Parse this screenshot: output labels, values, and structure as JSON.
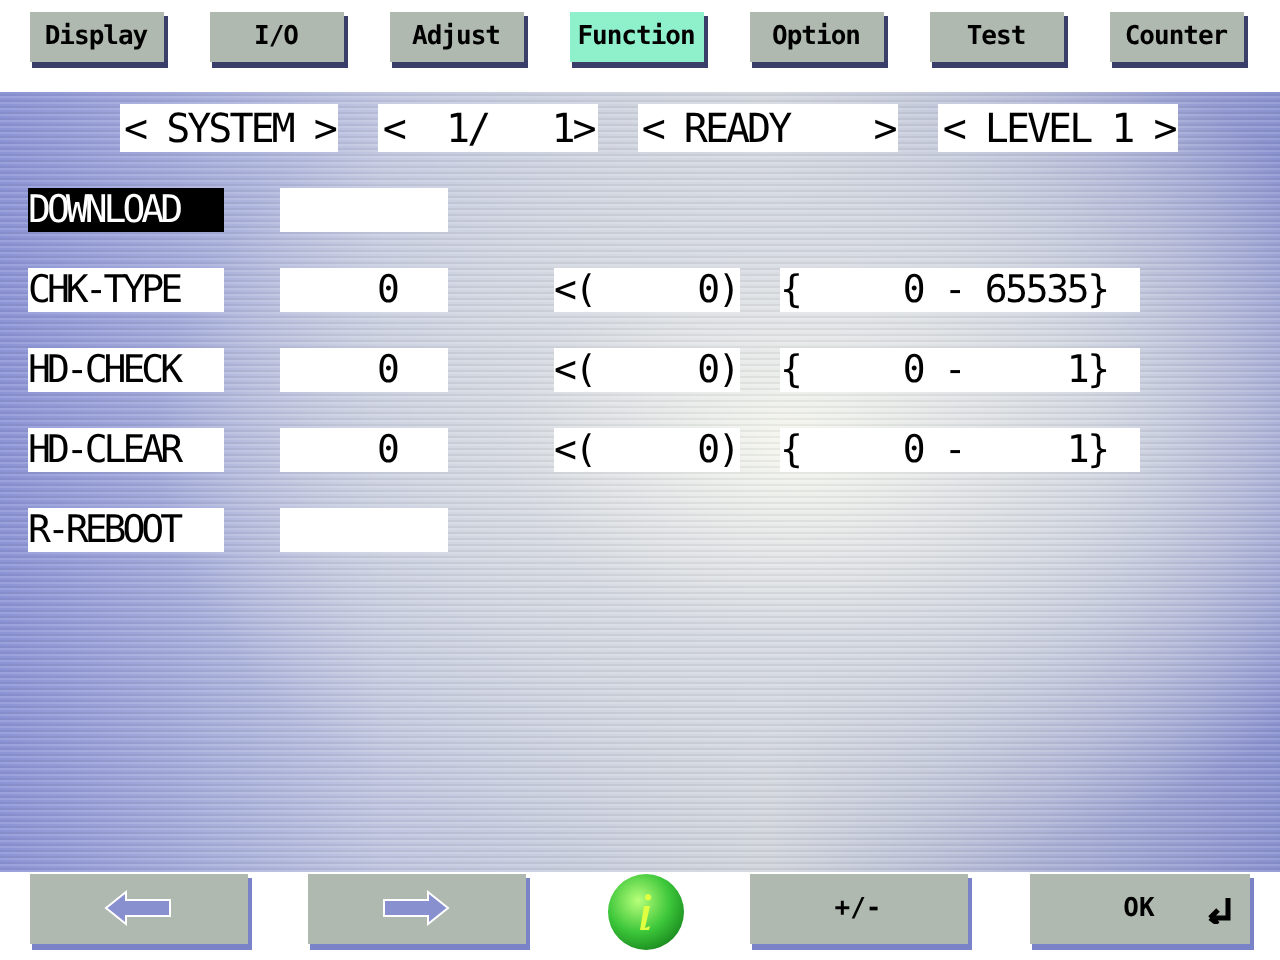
{
  "tabs": [
    {
      "label": "Display",
      "selected": false
    },
    {
      "label": "I/O",
      "selected": false
    },
    {
      "label": "Adjust",
      "selected": false
    },
    {
      "label": "Function",
      "selected": true
    },
    {
      "label": "Option",
      "selected": false
    },
    {
      "label": "Test",
      "selected": false
    },
    {
      "label": "Counter",
      "selected": false
    }
  ],
  "status": [
    "< SYSTEM >",
    "<  1/   1>",
    "< READY    >",
    "< LEVEL 1 >"
  ],
  "rows": [
    {
      "label": "DOWNLOAD",
      "selected": true,
      "value": ""
    },
    {
      "label": "CHK-TYPE",
      "selected": false,
      "value": "0",
      "previous": "<(     0)",
      "range": "{     0 - 65535}"
    },
    {
      "label": "HD-CHECK",
      "selected": false,
      "value": "0",
      "previous": "<(     0)",
      "range": "{     0 -     1}"
    },
    {
      "label": "HD-CLEAR",
      "selected": false,
      "value": "0",
      "previous": "<(     0)",
      "range": "{     0 -     1}"
    },
    {
      "label": "R-REBOOT",
      "selected": false,
      "value": ""
    }
  ],
  "footer": {
    "sign_button": "+/-",
    "ok_button": "OK"
  }
}
